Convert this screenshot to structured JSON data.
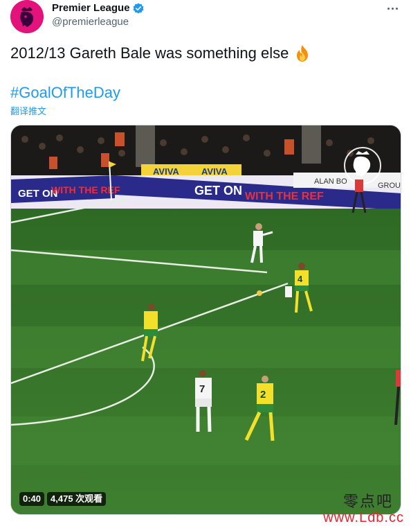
{
  "author": {
    "display_name": "Premier League",
    "handle": "@premierleague",
    "verified": true,
    "avatar_color": "#e3137b"
  },
  "tweet": {
    "text": "2012/13 Gareth Bale was something else",
    "emoji_icon": "fire-icon",
    "hashtag": "#GoalOfTheDay",
    "translate_label": "翻译推文"
  },
  "video": {
    "duration": "0:40",
    "views": "4,475 次观看",
    "board_texts": {
      "left": "GET ON",
      "left_red": "WITH THE REF",
      "middle": "GET ON",
      "middle_red": "WITH THE REF",
      "aviva": "AVIVA",
      "alan": "ALAN BO",
      "group": "GROUP"
    },
    "shirt_numbers": {
      "white_player_front": "7",
      "yellow_player_front": "2",
      "yellow_player_back": "4"
    }
  },
  "watermark": {
    "chinese": "零点吧",
    "url": "www.Ldb.cc"
  },
  "colors": {
    "link": "#1d9bf0",
    "secondary_text": "#536471",
    "pitch": "#3d7a2e"
  }
}
